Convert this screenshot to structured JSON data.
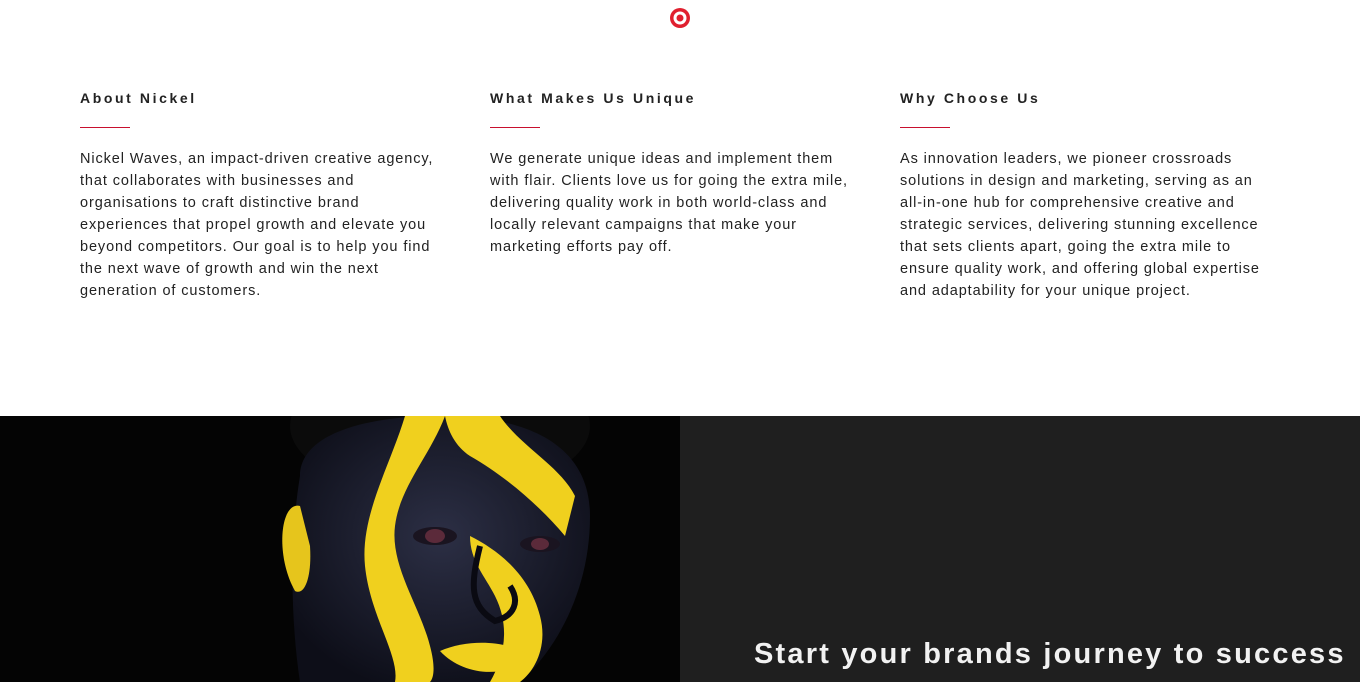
{
  "logo_icon": "target-icon",
  "accent_color": "#e0202f",
  "columns": [
    {
      "title": "About Nickel",
      "text": "Nickel Waves, an impact-driven creative agency, that collaborates with businesses and organisations to craft distinctive brand experiences that propel growth and elevate you beyond competitors. Our goal is to help you find the next wave of growth and win the next generation of customers."
    },
    {
      "title": "What Makes Us Unique",
      "text": "We generate unique ideas and implement them with flair. Clients love us for going the extra mile, delivering quality work in both world-class and locally relevant campaigns that make your marketing efforts pay off."
    },
    {
      "title": "Why Choose Us",
      "text": "As innovation leaders, we pioneer crossroads solutions in design and marketing, serving as an all-in-one hub for comprehensive creative and strategic services, delivering stunning excellence that sets clients apart, going the extra mile to ensure quality work, and offering global expertise and adaptability for your unique project."
    }
  ],
  "cta": {
    "title": "Start your brands journey to success"
  }
}
